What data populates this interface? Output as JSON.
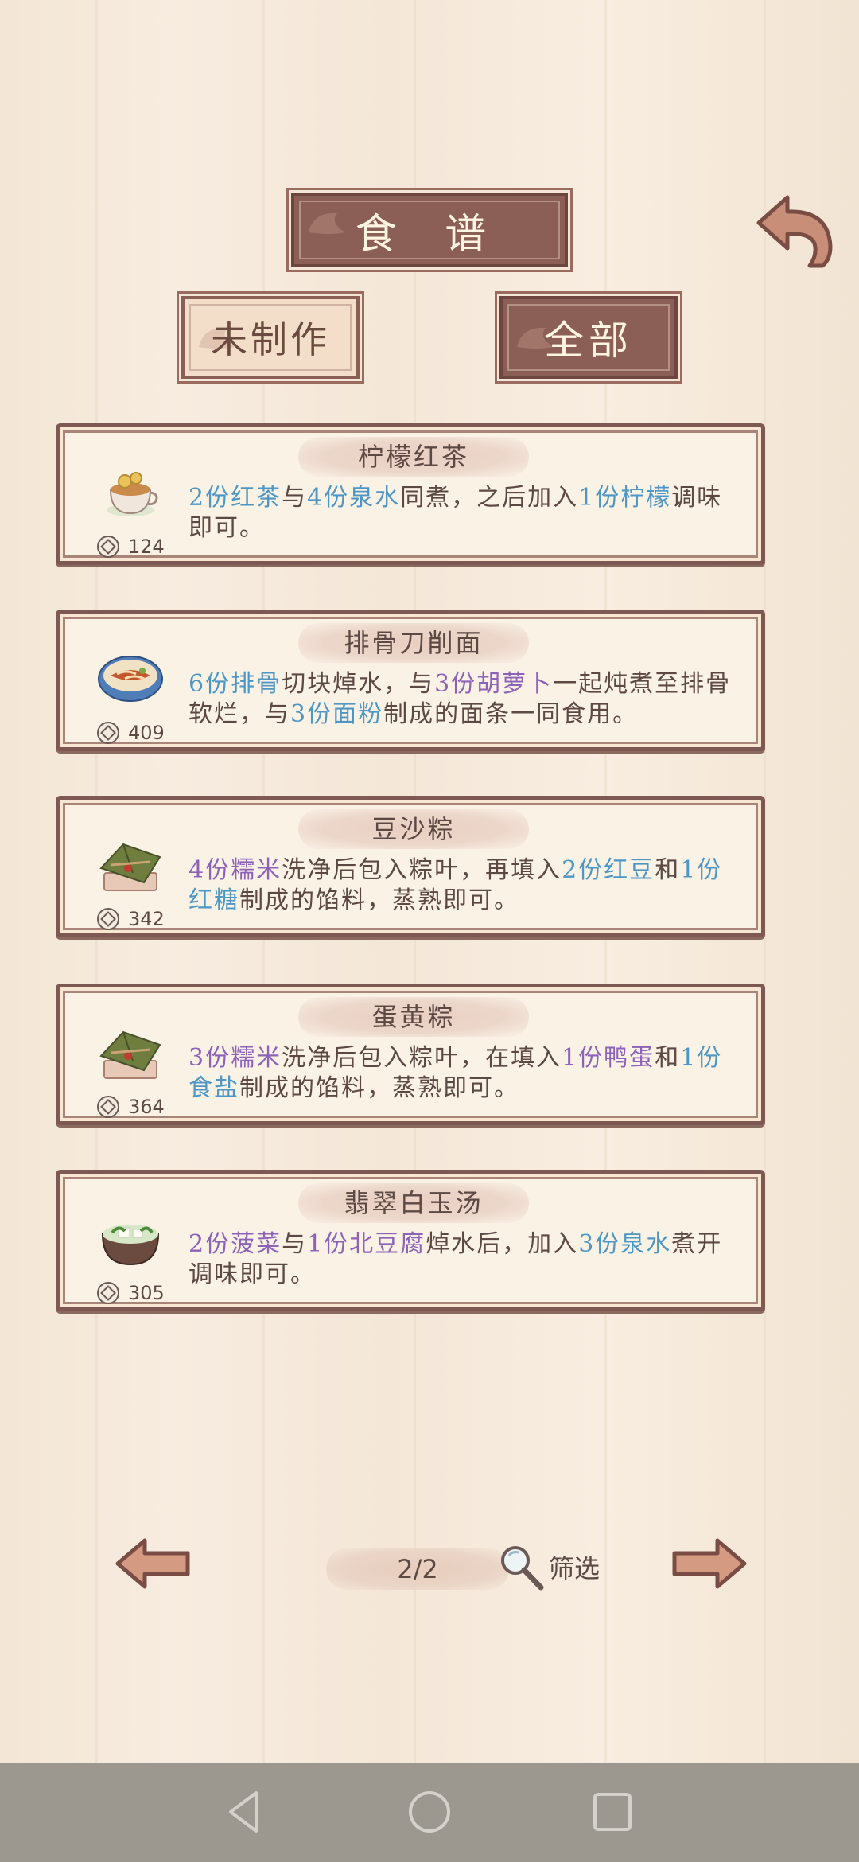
{
  "header": {
    "title": "食 谱"
  },
  "tabs": {
    "unmade": "未制作",
    "all": "全部"
  },
  "recipes": [
    {
      "name": "柠檬红茶",
      "price": "124",
      "dish_icon": "lemon-tea-icon",
      "desc": [
        {
          "t": "2份红茶",
          "c": "blue"
        },
        {
          "t": "与"
        },
        {
          "t": "4份泉水",
          "c": "blue"
        },
        {
          "t": "同煮，之后加入"
        },
        {
          "t": "1份柠檬",
          "c": "blue"
        },
        {
          "t": "调味即可。"
        }
      ]
    },
    {
      "name": "排骨刀削面",
      "price": "409",
      "dish_icon": "rib-noodle-icon",
      "desc": [
        {
          "t": "6份排骨",
          "c": "blue"
        },
        {
          "t": "切块焯水，与"
        },
        {
          "t": "3份胡萝卜",
          "c": "purple"
        },
        {
          "t": "一起炖煮至排骨软烂，与"
        },
        {
          "t": "3份面粉",
          "c": "blue"
        },
        {
          "t": "制成的面条一同食用。"
        }
      ]
    },
    {
      "name": "豆沙粽",
      "price": "342",
      "dish_icon": "zongzi-icon",
      "desc": [
        {
          "t": "4份糯米",
          "c": "purple"
        },
        {
          "t": "洗净后包入粽叶，再填入"
        },
        {
          "t": "2份红豆",
          "c": "blue"
        },
        {
          "t": "和"
        },
        {
          "t": "1份红糖",
          "c": "blue"
        },
        {
          "t": "制成的馅料，蒸熟即可。"
        }
      ]
    },
    {
      "name": "蛋黄粽",
      "price": "364",
      "dish_icon": "zongzi-icon",
      "desc": [
        {
          "t": "3份糯米",
          "c": "purple"
        },
        {
          "t": "洗净后包入粽叶，在填入"
        },
        {
          "t": "1份鸭蛋",
          "c": "purple"
        },
        {
          "t": "和"
        },
        {
          "t": "1份食盐",
          "c": "blue"
        },
        {
          "t": "制成的馅料，蒸熟即可。"
        }
      ]
    },
    {
      "name": "翡翠白玉汤",
      "price": "305",
      "dish_icon": "tofu-soup-icon",
      "desc": [
        {
          "t": "2份菠菜",
          "c": "purple"
        },
        {
          "t": "与"
        },
        {
          "t": "1份北豆腐",
          "c": "purple"
        },
        {
          "t": "焯水后，加入"
        },
        {
          "t": "3份泉水",
          "c": "blue"
        },
        {
          "t": "煮开调味即可。"
        }
      ]
    }
  ],
  "pager": {
    "page": "2/2",
    "filter_label": "筛选"
  },
  "colors": {
    "highlight_blue": "#4e97c4",
    "highlight_purple": "#8c63b8",
    "plaque": "#8c5f56"
  }
}
